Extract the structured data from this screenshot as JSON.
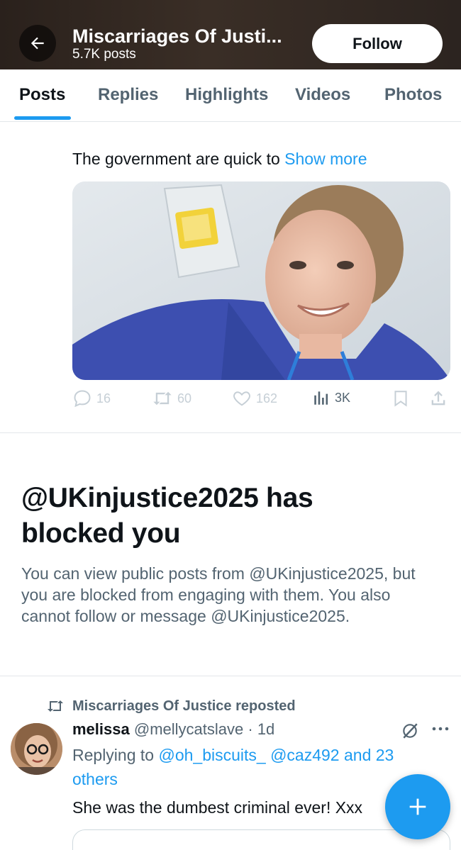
{
  "header": {
    "title": "Miscarriages Of Justi...",
    "post_count": "5.7K posts",
    "follow_label": "Follow"
  },
  "tabs": [
    {
      "label": "Posts",
      "active": true
    },
    {
      "label": "Replies",
      "active": false
    },
    {
      "label": "Highlights",
      "active": false
    },
    {
      "label": "Videos",
      "active": false
    },
    {
      "label": "Photos",
      "active": false
    }
  ],
  "post": {
    "text": "The government are quick to ",
    "show_more": "Show more",
    "media_icon": "photo-nurse-smiling",
    "actions": {
      "replies": "16",
      "reposts": "60",
      "likes": "162",
      "views": "3K"
    }
  },
  "blocked": {
    "title": "@UKinjustice2025 has blocked you",
    "description": "You can view public posts from @UKinjustice2025, but you are blocked from engaging with them. You also cannot follow or message @UKinjustice2025."
  },
  "repost": {
    "reposted_by": "Miscarriages Of Justice reposted",
    "author_name": "melissa",
    "author_handle": "@mellycatslave",
    "time": "1d",
    "replying_prefix": "Replying to ",
    "mention_1": "@oh_biscuits_",
    "mention_2": "@caz492",
    "others": "and 23 others",
    "text": "She was the dumbest criminal ever! Xxx"
  },
  "colors": {
    "accent": "#1d9bf0",
    "text_primary": "#0f1419",
    "text_secondary": "#536471",
    "header_bg": "#2f2620"
  },
  "icons": {
    "back": "arrow-left-icon",
    "reply": "comment-icon",
    "repost": "repost-icon",
    "like": "heart-icon",
    "views": "bar-chart-icon",
    "bookmark": "bookmark-icon",
    "share": "share-icon",
    "grok": "grok-icon",
    "more": "more-dots-icon",
    "compose": "plus-icon"
  }
}
